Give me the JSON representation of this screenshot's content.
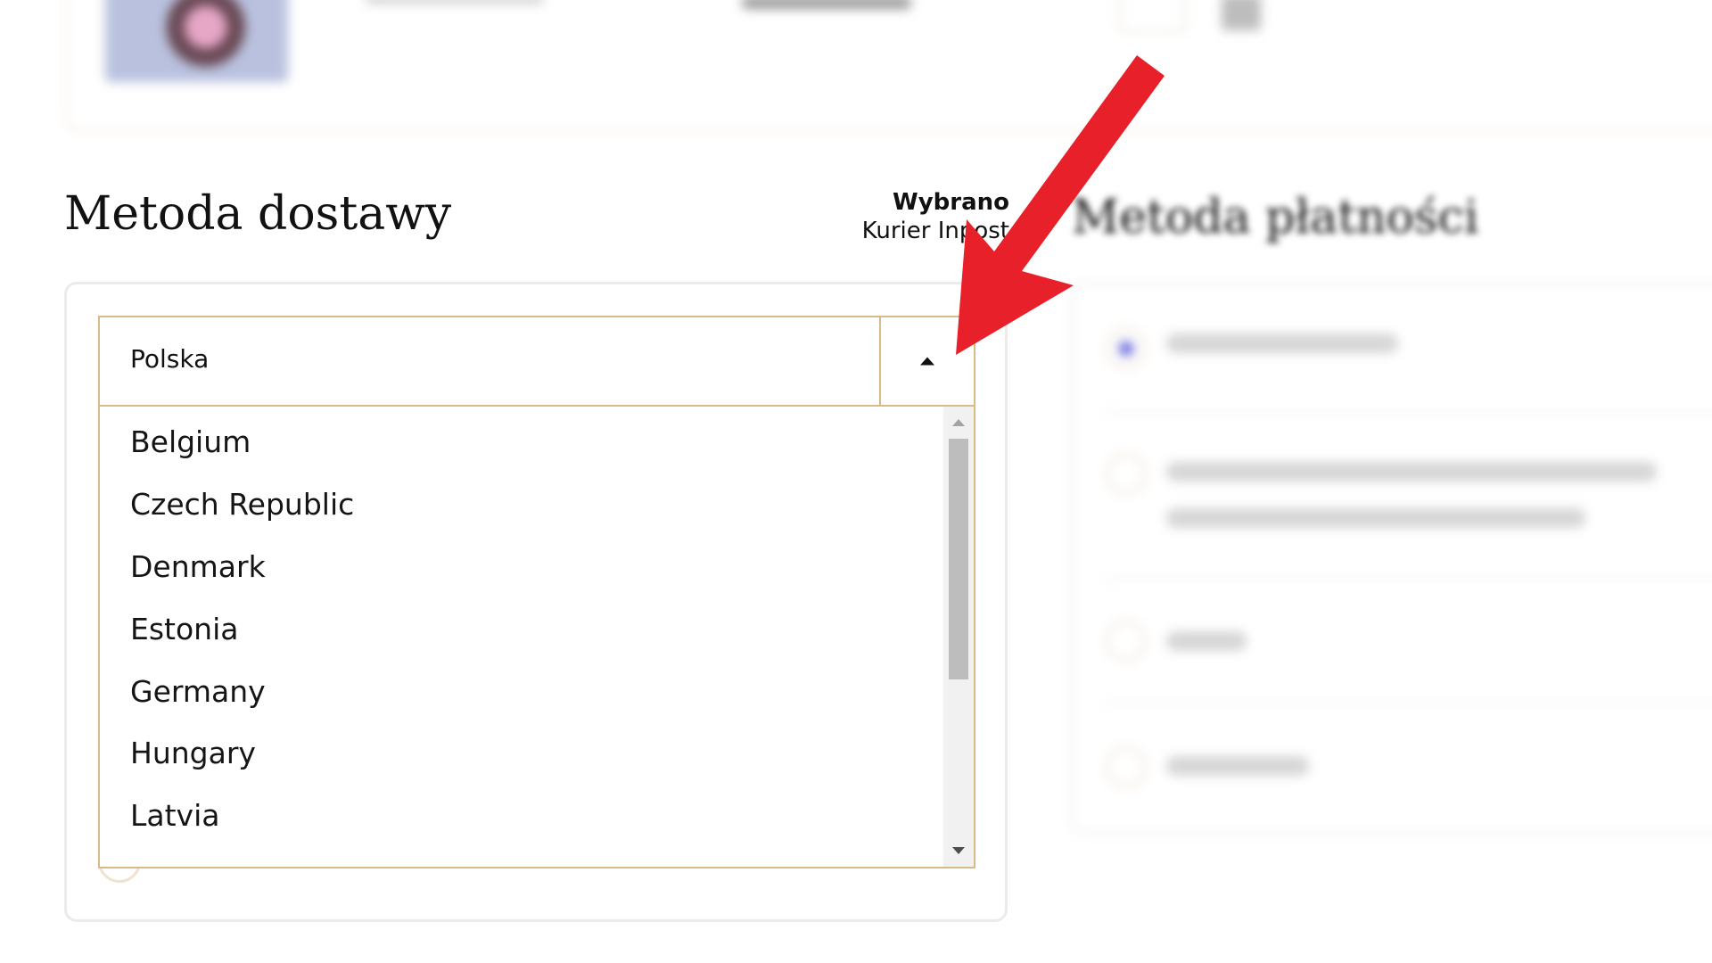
{
  "delivery": {
    "title": "Metoda dostawy",
    "selected_caption": "Wybrano",
    "selected_value": "Kurier Inpost",
    "country_select": {
      "value": "Polska",
      "options": [
        "Belgium",
        "Czech Republic",
        "Denmark",
        "Estonia",
        "Germany",
        "Hungary",
        "Latvia"
      ]
    }
  },
  "payment": {
    "title": "Metoda płatności"
  },
  "icons": {
    "dropdown_toggle": "caret-up-icon",
    "scroll_up": "scroll-up-arrow-icon",
    "scroll_down": "scroll-down-arrow-icon",
    "annotation": "red-arrow-annotation"
  },
  "colors": {
    "accent_border": "#d8b98a",
    "annotation_red": "#e8202a",
    "radio_checked": "#5b5bd6"
  }
}
